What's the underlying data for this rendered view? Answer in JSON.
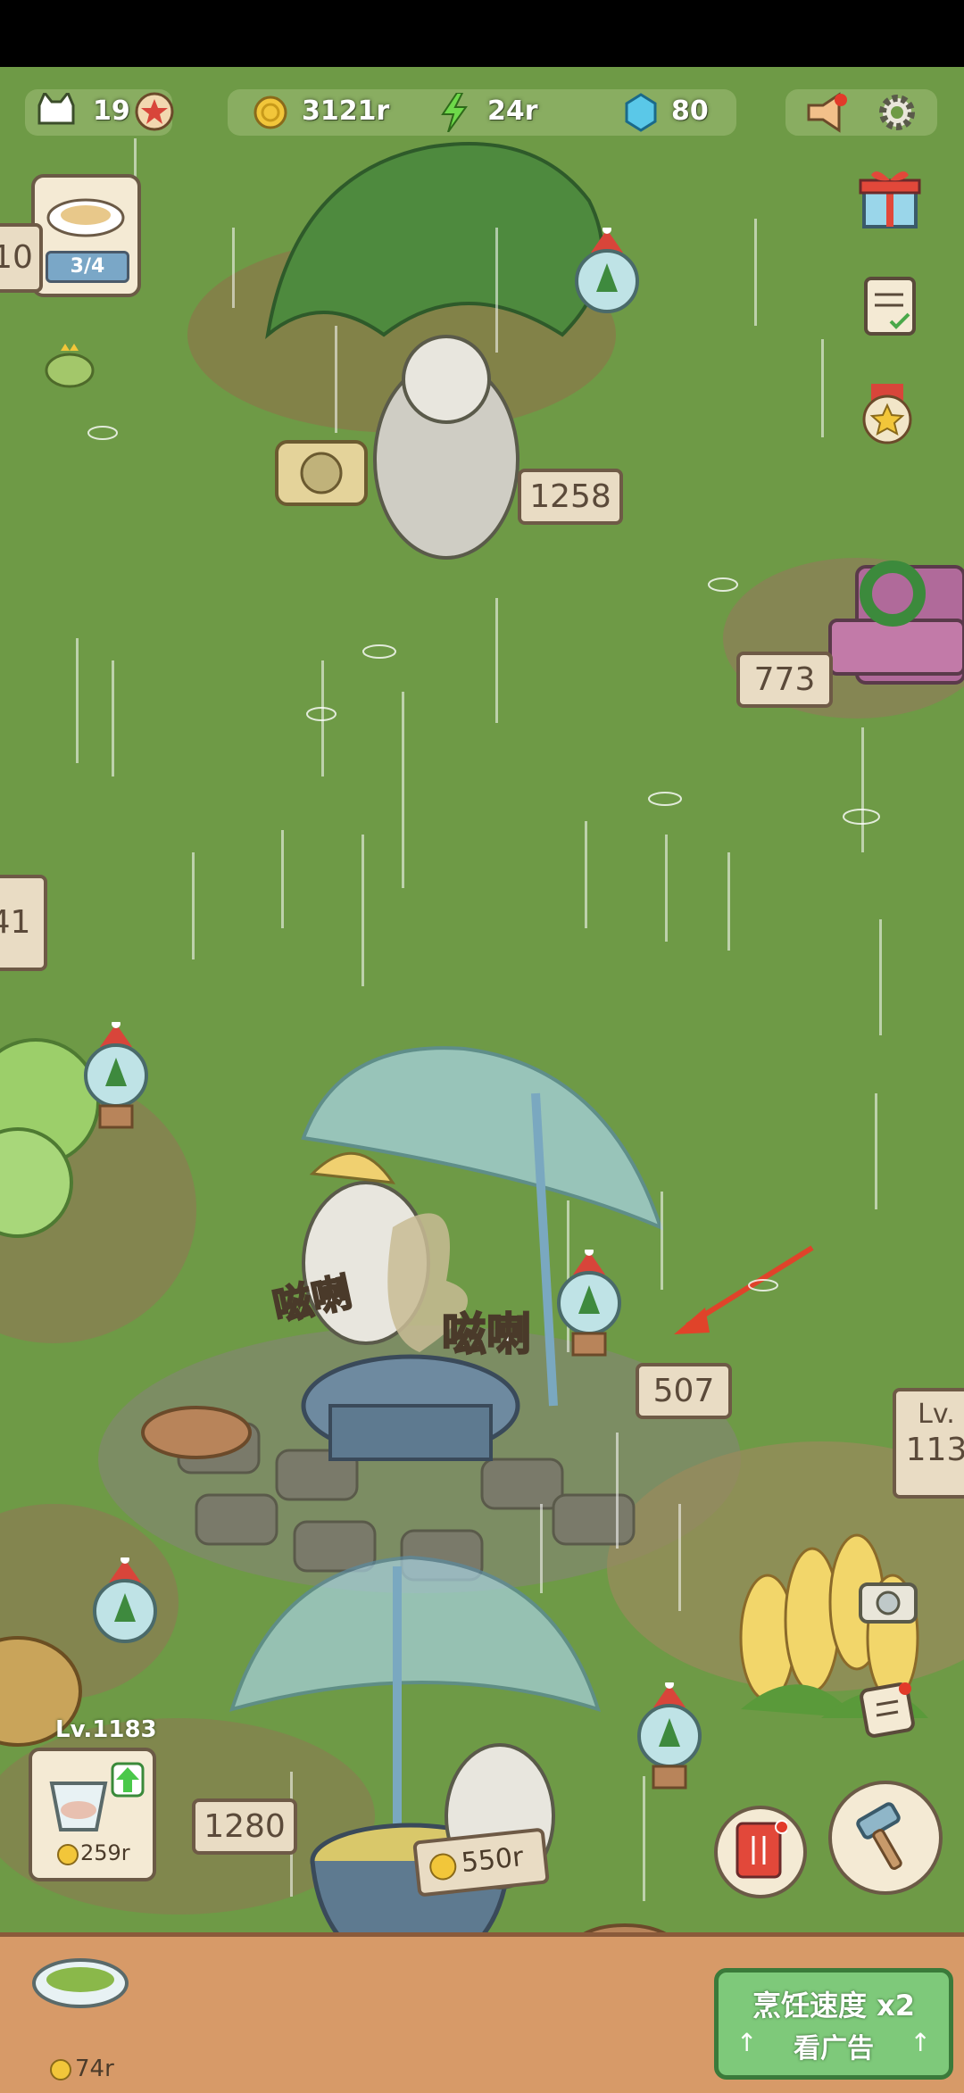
{
  "hud": {
    "cat_count": "19",
    "coins": "3121r",
    "energy": "24r",
    "gems": "80"
  },
  "order": {
    "progress": "3/4",
    "left_sign": "10"
  },
  "signs": {
    "tree_cat": "1258",
    "chair": "773",
    "left_edge": "41",
    "grill": "507",
    "bottom_left": "1280",
    "corn_level_top": "Lv.",
    "corn_level_num": "113"
  },
  "grill": {
    "sfx_left": "嗞喇",
    "sfx_right": "嗞喇"
  },
  "pot": {
    "price": "550r"
  },
  "upgrade": {
    "level": "Lv.1183",
    "cost": "259r"
  },
  "bottom": {
    "dish_price": "74r",
    "ad_title": "烹饪速度 x2",
    "ad_sub": "看广告"
  },
  "colors": {
    "grass": "#6e9a46",
    "sign_bg": "#e9dcc4",
    "ad_green": "#7ec97a",
    "arrow_red": "#e0432a",
    "wood_bar": "#d79a68"
  }
}
